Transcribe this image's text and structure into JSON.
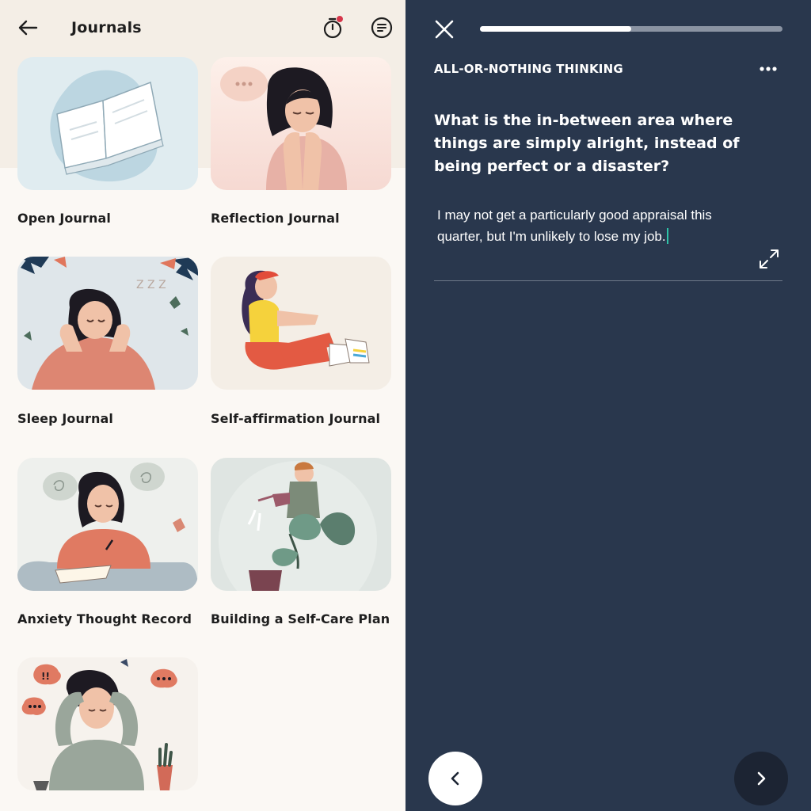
{
  "journals_screen": {
    "title": "Journals",
    "cards": [
      {
        "label": "Open Journal",
        "icon": "open-book-illustration"
      },
      {
        "label": "Reflection Journal",
        "icon": "thinking-woman-illustration"
      },
      {
        "label": "Sleep Journal",
        "icon": "sleeping-woman-illustration"
      },
      {
        "label": "Self-affirmation Journal",
        "icon": "sitting-woman-illustration"
      },
      {
        "label": "Anxiety Thought Record",
        "icon": "writing-woman-illustration"
      },
      {
        "label": "Building a Self-Care Plan",
        "icon": "watering-plant-illustration"
      },
      {
        "label": "",
        "icon": "stressed-man-illustration"
      }
    ]
  },
  "exercise_screen": {
    "progress": 0.5,
    "section_title": "ALL-OR-NOTHING THINKING",
    "question": "What is the in-between area where things are simply alright, instead of being perfect or a disaster?",
    "answer": "I may not get a particularly good appraisal this quarter, but I'm unlikely to lose my job.",
    "icons": {
      "close": "close-icon",
      "more": "more-icon",
      "expand": "expand-icon",
      "prev": "chevron-left-icon",
      "next": "chevron-right-icon"
    }
  },
  "colors": {
    "left_background": "#fbf8f4",
    "right_background": "#29374d",
    "notification_dot": "#d6364b",
    "caret": "#2ec3a8"
  }
}
